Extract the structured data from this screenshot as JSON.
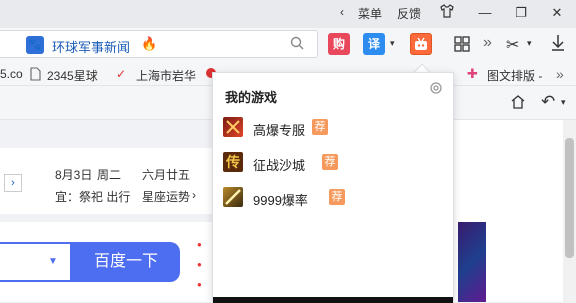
{
  "titlebar": {
    "menu": "菜单",
    "feedback": "反馈"
  },
  "toolbar": {
    "search_text": "环球军事新闻",
    "ext_buy": "购",
    "ext_translate": "译"
  },
  "bookmarks": [
    {
      "label": "5.co"
    },
    {
      "label": "2345星球"
    },
    {
      "label": "上海市岩华"
    },
    {
      "label": "图文排版 -"
    }
  ],
  "date_card": {
    "date": "8月3日",
    "weekday": "周二",
    "lunar": "六月廿五",
    "yi_label": "宜：祭祀 出行",
    "fortune_link": "星座运势"
  },
  "baidu": {
    "button_label": "百度一下"
  },
  "popup": {
    "title": "我的游戏",
    "games": [
      {
        "name": "高爆专服",
        "badge": "荐"
      },
      {
        "name": "征战沙城",
        "badge": "荐"
      },
      {
        "name": "9999爆率",
        "badge": "荐"
      }
    ]
  },
  "colors": {
    "accent_blue": "#4e6ef2",
    "badge_orange": "#f59a5c",
    "buy_red": "#e9475b",
    "translate_blue": "#2d8cf0",
    "game_ext_orange": "#ff6a3c"
  }
}
